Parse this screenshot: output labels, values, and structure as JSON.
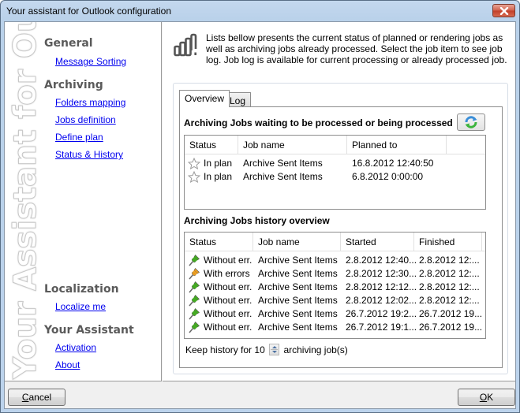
{
  "window": {
    "title": "Your assistant for Outlook configuration",
    "close_label": "Close"
  },
  "sidebar": {
    "watermark": "Your Assistant for Outlook",
    "sections": [
      {
        "heading": "General",
        "links": [
          "Message Sorting"
        ]
      },
      {
        "heading": "Archiving",
        "links": [
          "Folders mapping",
          "Jobs definition",
          "Define plan",
          "Status & History"
        ]
      },
      {
        "heading": "Localization",
        "links": [
          "Localize me"
        ]
      },
      {
        "heading": "Your Assistant",
        "links": [
          "Activation",
          "About"
        ]
      }
    ]
  },
  "main": {
    "intro_icon": "bar-chart-icon",
    "intro_text": "Lists bellow presents the current status of planned or rendering jobs as well as archiving jobs already processed. Select the job item to see job log. Job log is available for current processing or already processed job.",
    "tabs": [
      {
        "label": "Overview",
        "active": true
      },
      {
        "label": "Log",
        "active": false
      }
    ],
    "waiting": {
      "title": "Archiving Jobs waiting to be processed or being processed",
      "refresh_icon": "refresh-icon",
      "columns": [
        "Status",
        "Job name",
        "Planned to",
        ""
      ],
      "rows": [
        {
          "icon": "star-outline-icon",
          "status": "In plan",
          "job": "Archive Sent Items",
          "planned": "16.8.2012 12:40:50"
        },
        {
          "icon": "star-outline-icon",
          "status": "In plan",
          "job": "Archive Sent Items",
          "planned": "6.8.2012 0:00:00"
        }
      ]
    },
    "history": {
      "title": "Archiving Jobs history overview",
      "columns": [
        "Status",
        "Job name",
        "Started",
        "Finished"
      ],
      "rows": [
        {
          "icon": "green-pin-icon",
          "status": "Without err...",
          "job": "Archive Sent Items",
          "started": "2.8.2012 12:40...",
          "finished": "2.8.2012 12:..."
        },
        {
          "icon": "orange-pin-icon",
          "status": "With errors",
          "job": "Archive Sent Items",
          "started": "2.8.2012 12:30...",
          "finished": "2.8.2012 12:..."
        },
        {
          "icon": "green-pin-icon",
          "status": "Without err...",
          "job": "Archive Sent Items",
          "started": "2.8.2012 12:12...",
          "finished": "2.8.2012 12:..."
        },
        {
          "icon": "green-pin-icon",
          "status": "Without err...",
          "job": "Archive Sent Items",
          "started": "2.8.2012 12:02...",
          "finished": "2.8.2012 12:..."
        },
        {
          "icon": "green-pin-icon",
          "status": "Without err...",
          "job": "Archive Sent Items",
          "started": "26.7.2012 19:2...",
          "finished": "26.7.2012 19..."
        },
        {
          "icon": "green-pin-icon",
          "status": "Without err...",
          "job": "Archive Sent Items",
          "started": "26.7.2012 19:1...",
          "finished": "26.7.2012 19..."
        }
      ]
    },
    "keep_history": {
      "prefix": "Keep history for",
      "value": "10",
      "suffix": "archiving job(s)"
    }
  },
  "footer": {
    "cancel_label": "Cancel",
    "cancel_mnemonic": "C",
    "cancel_rest": "ancel",
    "ok_label": "OK",
    "ok_mnemonic": "O",
    "ok_rest": "K"
  },
  "colors": {
    "link": "#0000ee",
    "heading": "#5a5a5a",
    "pin_ok": "#44b020",
    "pin_error": "#f0a020"
  }
}
